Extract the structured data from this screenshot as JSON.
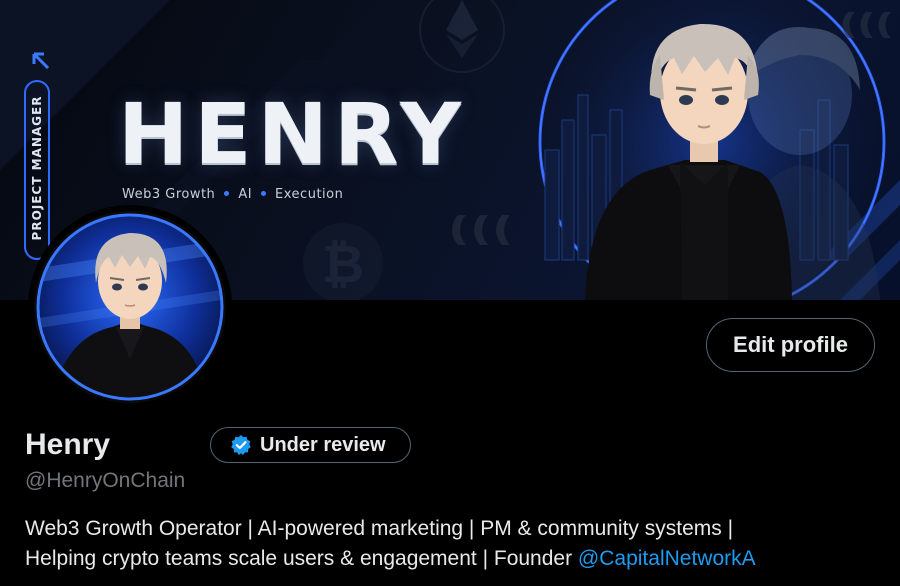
{
  "banner": {
    "title": "HENRY",
    "tagline": [
      "Web3 Growth",
      "AI",
      "Execution"
    ],
    "role": "PROJECT MANAGER"
  },
  "profile": {
    "display_name": "Henry",
    "handle": "@HenryOnChain",
    "verification_label": "Under review",
    "edit_button_label": "Edit profile",
    "bio_line1": "Web3 Growth Operator | AI-powered marketing | PM & community systems |",
    "bio_line2_text": "Helping crypto teams scale users & engagement | Founder ",
    "bio_mention": "@CapitalNetworkA"
  },
  "icons": {
    "verified": "verified-badge-icon",
    "arrow": "arrow-up-left-icon",
    "ethereum": "ethereum-icon",
    "bitcoin": "bitcoin-icon"
  },
  "colors": {
    "accent": "#1d9bf0",
    "banner_blue": "#2f6bff",
    "muted": "#71767b",
    "border": "#536471"
  }
}
